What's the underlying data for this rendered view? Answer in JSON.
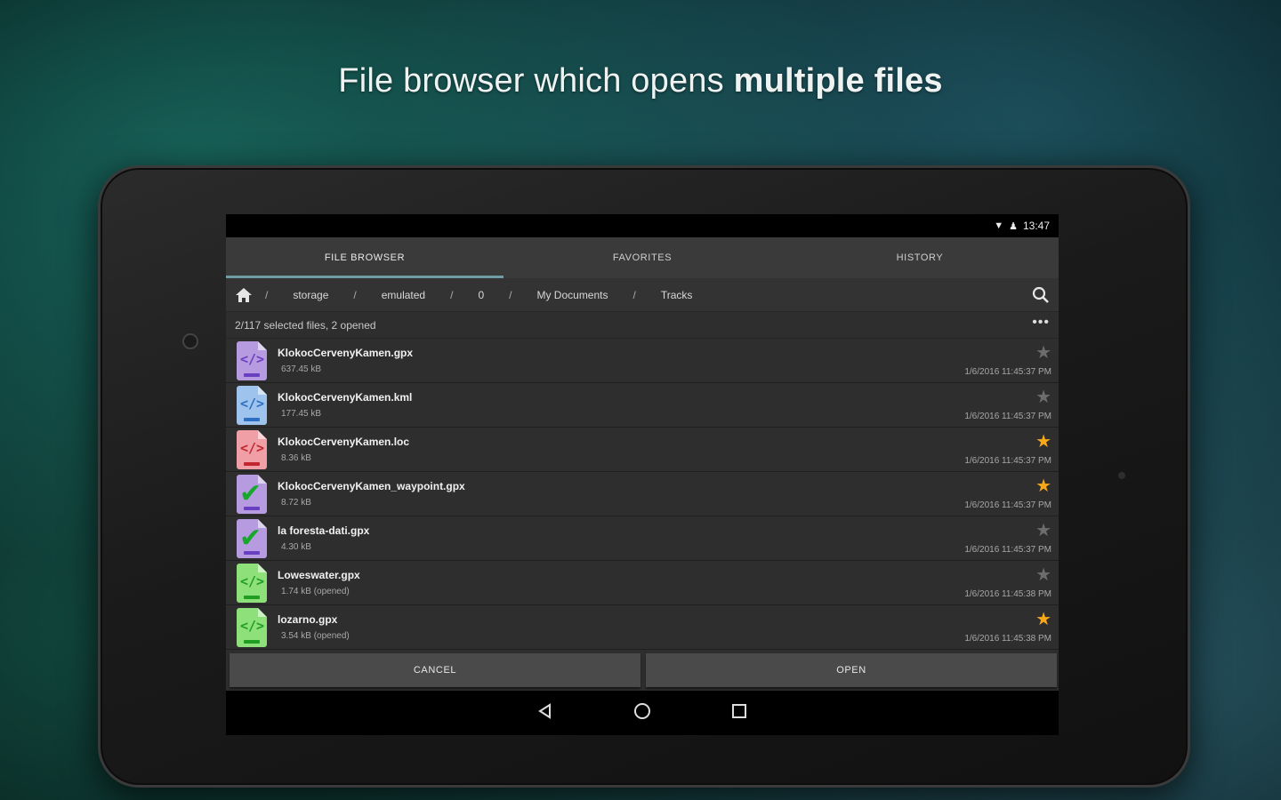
{
  "headline": {
    "normal": "File browser which opens ",
    "bold": "multiple files"
  },
  "statusbar": {
    "time": "13:47",
    "wifi_icon": "wifi-icon",
    "account_icon": "person-icon"
  },
  "tabs": [
    {
      "label": "FILE BROWSER",
      "active": true
    },
    {
      "label": "FAVORITES",
      "active": false
    },
    {
      "label": "HISTORY",
      "active": false
    }
  ],
  "breadcrumb": {
    "home_icon": "home-icon",
    "separator": "/",
    "items": [
      "storage",
      "emulated",
      "0",
      "My Documents",
      "Tracks"
    ],
    "search_icon": "search-icon"
  },
  "selection": {
    "text": "2/117 selected files, 2 opened",
    "more_icon": "more-horizontal-icon",
    "more": "•••"
  },
  "files": [
    {
      "name": "KlokocCervenyKamen.gpx",
      "size": "637.45 kB",
      "date": "1/6/2016 11:45:37 PM",
      "starred": false,
      "checked": false,
      "color": "#b79be0",
      "code_color": "#6a3fc0"
    },
    {
      "name": "KlokocCervenyKamen.kml",
      "size": "177.45 kB",
      "date": "1/6/2016 11:45:37 PM",
      "starred": false,
      "checked": false,
      "color": "#9ec3ec",
      "code_color": "#2e6fc4"
    },
    {
      "name": "KlokocCervenyKamen.loc",
      "size": "8.36 kB",
      "date": "1/6/2016 11:45:37 PM",
      "starred": true,
      "checked": false,
      "color": "#ef9fa5",
      "code_color": "#c4262f"
    },
    {
      "name": "KlokocCervenyKamen_waypoint.gpx",
      "size": "8.72 kB",
      "date": "1/6/2016 11:45:37 PM",
      "starred": true,
      "checked": true,
      "color": "#b79be0",
      "code_color": "#6a3fc0"
    },
    {
      "name": "la foresta-dati.gpx",
      "size": "4.30 kB",
      "date": "1/6/2016 11:45:37 PM",
      "starred": false,
      "checked": true,
      "color": "#b79be0",
      "code_color": "#6a3fc0"
    },
    {
      "name": "Loweswater.gpx",
      "size": "1.74 kB (opened)",
      "date": "1/6/2016 11:45:38 PM",
      "starred": false,
      "checked": false,
      "color": "#8ee07a",
      "code_color": "#1f9e22"
    },
    {
      "name": "lozarno.gpx",
      "size": "3.54 kB (opened)",
      "date": "1/6/2016 11:45:38 PM",
      "starred": true,
      "checked": false,
      "color": "#8ee07a",
      "code_color": "#1f9e22"
    }
  ],
  "actions": {
    "cancel": "CANCEL",
    "open": "OPEN"
  },
  "navbar": {
    "back_icon": "back-triangle-icon",
    "home_icon": "home-circle-icon",
    "recents_icon": "recents-square-icon"
  },
  "colors": {
    "tab_indicator": "#6f9da6",
    "star_on": "#f7a71a",
    "star_off": "#6d6d6d"
  }
}
